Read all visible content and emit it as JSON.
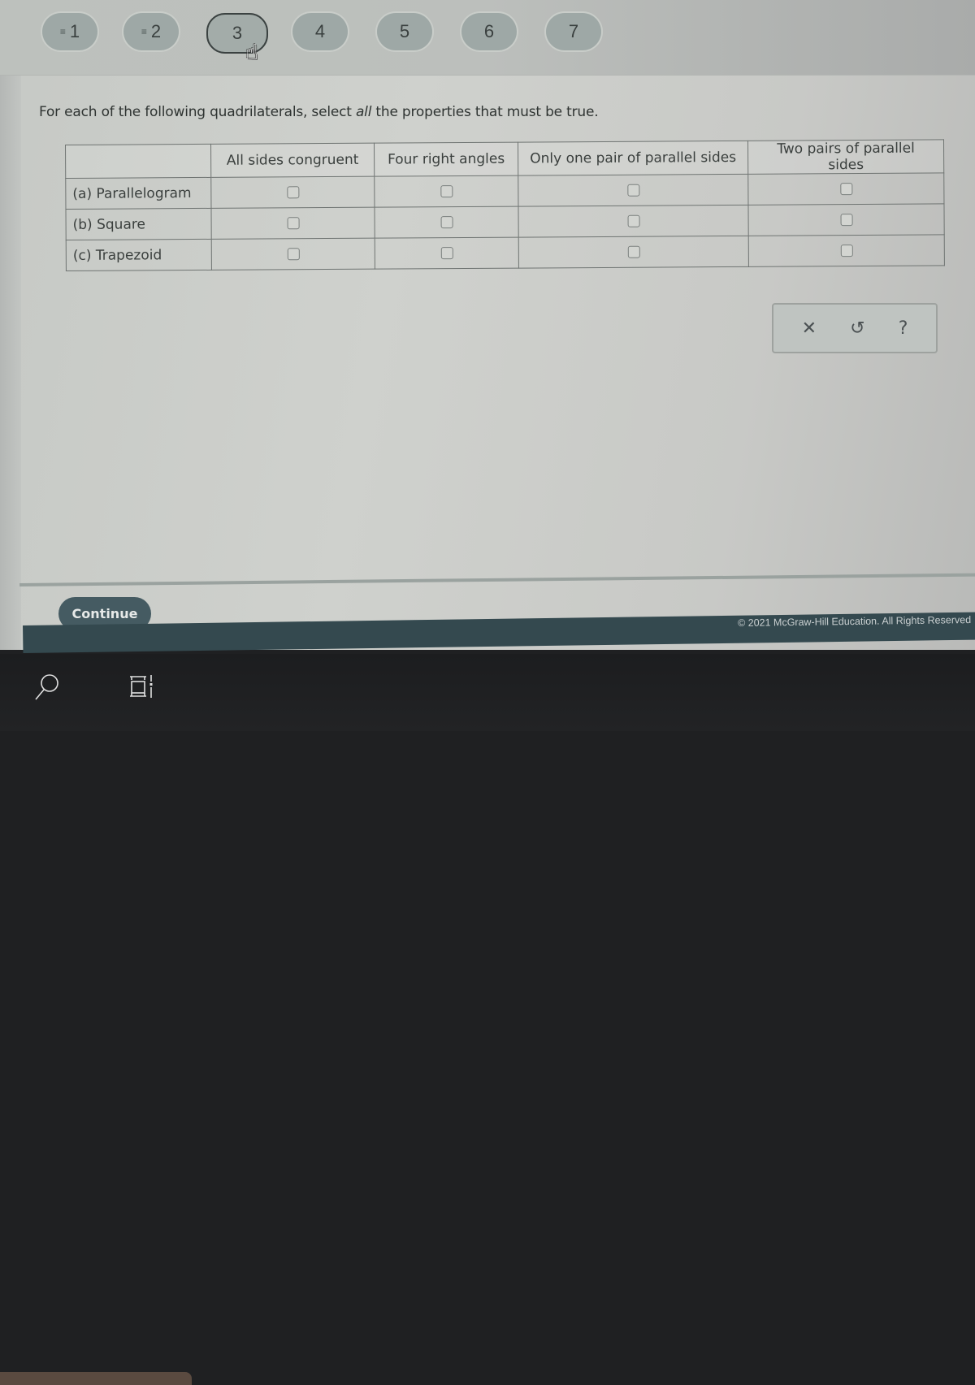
{
  "question_nav": {
    "items": [
      {
        "label": "1",
        "status_icon": "answered-lines-icon",
        "current": false
      },
      {
        "label": "2",
        "status_icon": "answered-lines-icon",
        "current": false
      },
      {
        "label": "3",
        "status_icon": null,
        "current": true
      },
      {
        "label": "4",
        "status_icon": null,
        "current": false
      },
      {
        "label": "5",
        "status_icon": null,
        "current": false
      },
      {
        "label": "6",
        "status_icon": null,
        "current": false
      },
      {
        "label": "7",
        "status_icon": null,
        "current": false
      }
    ],
    "answered_glyph": "≡",
    "cursor_glyph": "☝"
  },
  "prompt": {
    "before": "For each of the following quadrilaterals, select ",
    "emphasis": "all",
    "after": " the properties that must be true."
  },
  "table": {
    "columns": [
      "All sides congruent",
      "Four right angles",
      "Only one pair of parallel sides",
      "Two pairs of parallel sides"
    ],
    "rows": [
      {
        "label": "(a) Parallelogram",
        "checked": [
          false,
          false,
          false,
          false
        ]
      },
      {
        "label": "(b) Square",
        "checked": [
          false,
          false,
          false,
          false
        ]
      },
      {
        "label": "(c) Trapezoid",
        "checked": [
          false,
          false,
          false,
          false
        ]
      }
    ]
  },
  "toolbar": {
    "clear_glyph": "✕",
    "undo_glyph": "↺",
    "help_glyph": "?"
  },
  "footer": {
    "continue_label": "Continue",
    "copyright": "© 2021 McGraw-Hill Education. All Rights Reserved"
  },
  "colors": {
    "accent": "#455b62",
    "footer_bar": "#34494f",
    "nav_button": "#9ea8a6"
  }
}
